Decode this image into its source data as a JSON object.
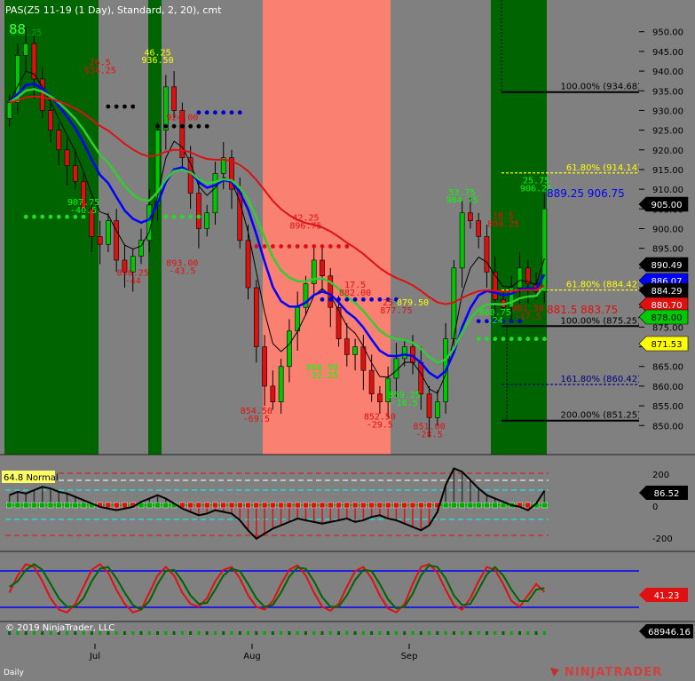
{
  "header": {
    "title": "PAS(Z5 11-19 (1 Day), Standard, 2, 20), cmt",
    "bar_count": "88"
  },
  "footer": {
    "copyright": "© 2019 NinjaTrader, LLC",
    "period": "Daily",
    "brand": "NINJATRADER"
  },
  "colors": {
    "background": "#808080",
    "bull_zone": "#006400",
    "bear_zone": "#fa8072",
    "bull_candle": "#00c800",
    "bear_candle": "#e01010",
    "ema_fast": "#0000ff",
    "ema_mid": "#33cc33",
    "ema_slow": "#dd1111",
    "fib_line": "#000000"
  },
  "chart_data": [
    {
      "type": "candlestick",
      "title": "PAS(Z5 11-19 (1 Day), Standard, 2, 20), cmt",
      "x_labels": [
        "Jul",
        "Aug",
        "Sep"
      ],
      "ylim": [
        846,
        954
      ],
      "y_ticks": [
        850,
        855,
        860,
        865,
        870,
        875,
        880,
        885,
        890,
        895,
        900,
        905,
        910,
        915,
        920,
        925,
        930,
        935,
        940,
        945,
        950
      ],
      "price_labels": [
        {
          "value": "905.00",
          "color": "#000000"
        },
        {
          "value": "890.49",
          "color": "#000000"
        },
        {
          "value": "886.07",
          "color": "#0000ff"
        },
        {
          "value": "884.29",
          "color": "#000000"
        },
        {
          "value": "880.70",
          "color": "#e01010"
        },
        {
          "value": "878.00",
          "color": "#00c800"
        },
        {
          "value": "871.53",
          "color": "#ffff00"
        }
      ],
      "fib_levels": [
        {
          "label": "100.00% (934.68)",
          "value": 934.68,
          "color": "#000000"
        },
        {
          "label": "61.80% (914.14)",
          "value": 914.14,
          "color": "#ffff00"
        },
        {
          "label": "61.80% (884.42)",
          "value": 884.42,
          "color": "#ffff00"
        },
        {
          "label": "100.00% (875.25)",
          "value": 875.25,
          "color": "#000000"
        },
        {
          "label": "161.80% (860.42)",
          "value": 860.42,
          "color": "#000080"
        },
        {
          "label": "200.00% (851.25)",
          "value": 851.25,
          "color": "#000000"
        }
      ],
      "annotations": [
        {
          "text": "945.25",
          "price": 949,
          "color": "#00a000",
          "xi": 2
        },
        {
          "text": "26.5",
          "price": 941.5,
          "color": "#e01010",
          "xi": 11
        },
        {
          "text": "934.25",
          "price": 939.5,
          "color": "#e01010",
          "xi": 11
        },
        {
          "text": "46.25",
          "price": 944,
          "color": "#ffff00",
          "xi": 18
        },
        {
          "text": "936.50",
          "price": 942,
          "color": "#ffff00",
          "xi": 18
        },
        {
          "text": "924.00",
          "price": 927.5,
          "color": "#e01010",
          "xi": 21
        },
        {
          "text": "907.75",
          "price": 906,
          "color": "#00ff00",
          "xi": 9
        },
        {
          "text": "-40.5",
          "price": 904,
          "color": "#00ff00",
          "xi": 9
        },
        {
          "text": "890.25",
          "price": 888,
          "color": "#e01010",
          "xi": 15
        },
        {
          "text": "-44",
          "price": 886,
          "color": "#e01010",
          "xi": 15
        },
        {
          "text": "893.00",
          "price": 890.5,
          "color": "#e01010",
          "xi": 21
        },
        {
          "text": "-43.5",
          "price": 888.5,
          "color": "#e01010",
          "xi": 21
        },
        {
          "text": "42.25",
          "price": 902,
          "color": "#e01010",
          "xi": 36
        },
        {
          "text": "896.75",
          "price": 900,
          "color": "#e01010",
          "xi": 36
        },
        {
          "text": "17.5",
          "price": 885,
          "color": "#e01010",
          "xi": 42
        },
        {
          "text": "882.00",
          "price": 883,
          "color": "#e01010",
          "xi": 42
        },
        {
          "text": "25",
          "price": 880.5,
          "color": "#e01010",
          "xi": 46
        },
        {
          "text": "877.75",
          "price": 878.5,
          "color": "#e01010",
          "xi": 47
        },
        {
          "text": "879.50",
          "price": 880.5,
          "color": "#ffff00",
          "xi": 49
        },
        {
          "text": "866.50",
          "price": 864,
          "color": "#00ff00",
          "xi": 38
        },
        {
          "text": "-32.25",
          "price": 862,
          "color": "#00ff00",
          "xi": 38
        },
        {
          "text": "859.25",
          "price": 857,
          "color": "#00ff00",
          "xi": 48
        },
        {
          "text": "-18.5",
          "price": 855,
          "color": "#00ff00",
          "xi": 48
        },
        {
          "text": "854.50",
          "price": 853,
          "color": "#e01010",
          "xi": 30
        },
        {
          "text": "-69.5",
          "price": 851,
          "color": "#e01010",
          "xi": 30
        },
        {
          "text": "852.50",
          "price": 851.5,
          "color": "#e01010",
          "xi": 45
        },
        {
          "text": "-29.5",
          "price": 849.5,
          "color": "#e01010",
          "xi": 45
        },
        {
          "text": "851.00",
          "price": 849,
          "color": "#e01010",
          "xi": 51
        },
        {
          "text": "-28.5",
          "price": 847,
          "color": "#e01010",
          "xi": 51
        },
        {
          "text": "53.75",
          "price": 908.5,
          "color": "#00ff00",
          "xi": 55
        },
        {
          "text": "904.75",
          "price": 906.5,
          "color": "#00ff00",
          "xi": 55
        },
        {
          "text": "18.5",
          "price": 902.5,
          "color": "#e01010",
          "xi": 60
        },
        {
          "text": "899.25",
          "price": 900.5,
          "color": "#e01010",
          "xi": 60
        },
        {
          "text": "25.75",
          "price": 911.5,
          "color": "#00ff00",
          "xi": 64
        },
        {
          "text": "906.25",
          "price": 909.5,
          "color": "#00ff00",
          "xi": 64
        },
        {
          "text": "880.75",
          "price": 878,
          "color": "#00ff00",
          "xi": 59
        },
        {
          "text": "-24",
          "price": 876,
          "color": "#00ff00",
          "xi": 59
        },
        {
          "text": "881.50",
          "price": 879,
          "color": "#e01010",
          "xi": 63
        },
        {
          "text": "-17.5",
          "price": 877,
          "color": "#e01010",
          "xi": 63
        }
      ],
      "side_labels": [
        {
          "text": "889.25 906.75",
          "price": 908,
          "color": "#0000ff"
        },
        {
          "text": "881.5 883.75",
          "price": 878.5,
          "color": "#e01010"
        }
      ]
    },
    {
      "type": "histogram",
      "title": "64.8 Normal",
      "y_ticks": [
        200,
        0,
        -200
      ],
      "last_value": "86.52",
      "values": [
        60,
        80,
        70,
        90,
        110,
        100,
        80,
        70,
        50,
        30,
        10,
        -10,
        -20,
        -30,
        -20,
        -10,
        20,
        40,
        60,
        40,
        10,
        -20,
        -40,
        -60,
        -50,
        -30,
        -40,
        -50,
        -90,
        -150,
        -200,
        -170,
        -140,
        -120,
        -100,
        -80,
        -90,
        -100,
        -110,
        -100,
        -90,
        -80,
        -100,
        -90,
        -70,
        -60,
        -80,
        -90,
        -110,
        -130,
        -150,
        -120,
        -40,
        120,
        220,
        200,
        150,
        100,
        60,
        40,
        20,
        0,
        -10,
        -30,
        10,
        86.52
      ]
    },
    {
      "type": "line",
      "title": "",
      "last_value": "41.23",
      "series": [
        {
          "color": "#e01010",
          "values": [
            40,
            70,
            90,
            85,
            60,
            30,
            10,
            5,
            20,
            50,
            80,
            90,
            75,
            45,
            20,
            5,
            10,
            40,
            70,
            85,
            70,
            40,
            20,
            15,
            30,
            60,
            80,
            85,
            65,
            35,
            15,
            10,
            25,
            55,
            80,
            88,
            70,
            40,
            15,
            8,
            20,
            50,
            78,
            85,
            65,
            35,
            12,
            5,
            20,
            55,
            85,
            90,
            75,
            45,
            18,
            10,
            30,
            60,
            85,
            80,
            55,
            25,
            15,
            35,
            55,
            41
          ]
        },
        {
          "color": "#006400",
          "values": [
            50,
            60,
            80,
            90,
            80,
            55,
            30,
            15,
            15,
            30,
            60,
            82,
            85,
            65,
            40,
            18,
            10,
            25,
            55,
            78,
            80,
            60,
            35,
            20,
            22,
            45,
            70,
            82,
            78,
            55,
            30,
            15,
            18,
            40,
            68,
            84,
            82,
            60,
            32,
            15,
            15,
            35,
            62,
            80,
            78,
            55,
            28,
            12,
            15,
            38,
            70,
            88,
            85,
            65,
            35,
            18,
            20,
            45,
            72,
            85,
            70,
            45,
            25,
            25,
            45,
            48
          ]
        }
      ]
    },
    {
      "type": "bar",
      "title": "Volume",
      "last_value": "68946.16",
      "values": [
        1,
        1,
        1,
        1,
        1,
        1,
        1,
        1,
        1,
        1,
        1,
        1,
        1,
        1,
        1,
        1,
        1,
        1,
        1,
        1,
        1,
        1,
        1,
        1,
        1,
        1,
        1,
        1,
        1,
        1,
        1,
        1,
        1,
        1,
        1,
        1,
        1,
        1,
        1,
        1,
        1,
        1,
        1,
        1,
        1,
        1,
        1,
        1,
        1,
        1,
        1,
        1,
        1,
        1,
        1,
        1,
        1,
        1,
        1,
        1,
        1,
        1,
        1,
        1,
        1,
        1
      ]
    }
  ]
}
